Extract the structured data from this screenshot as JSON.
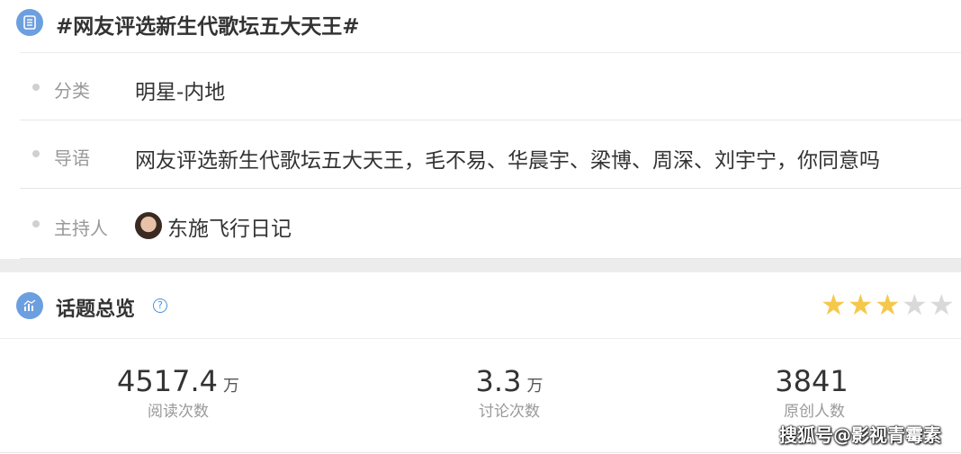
{
  "topic": {
    "title": "#网友评选新生代歌坛五大天王#",
    "rows": [
      {
        "label": "分类",
        "value": "明星-内地"
      },
      {
        "label": "导语",
        "value": "网友评选新生代歌坛五大天王，毛不易、华晨宇、梁博、周深、刘宇宁，你同意吗"
      },
      {
        "label": "主持人",
        "value": "东施飞行日记"
      }
    ]
  },
  "overview": {
    "title": "话题总览",
    "help_icon": "question-circle-icon",
    "rating": {
      "value": 3,
      "max": 5,
      "filled_color": "#f5c84c",
      "empty_color": "#d9d9d9"
    },
    "stats": [
      {
        "number": "4517.4",
        "unit": "万",
        "label": "阅读次数"
      },
      {
        "number": "3.3",
        "unit": "万",
        "label": "讨论次数"
      },
      {
        "number": "3841",
        "unit": "",
        "label": "原创人数"
      }
    ]
  },
  "watermark": "搜狐号@影视青霉素"
}
